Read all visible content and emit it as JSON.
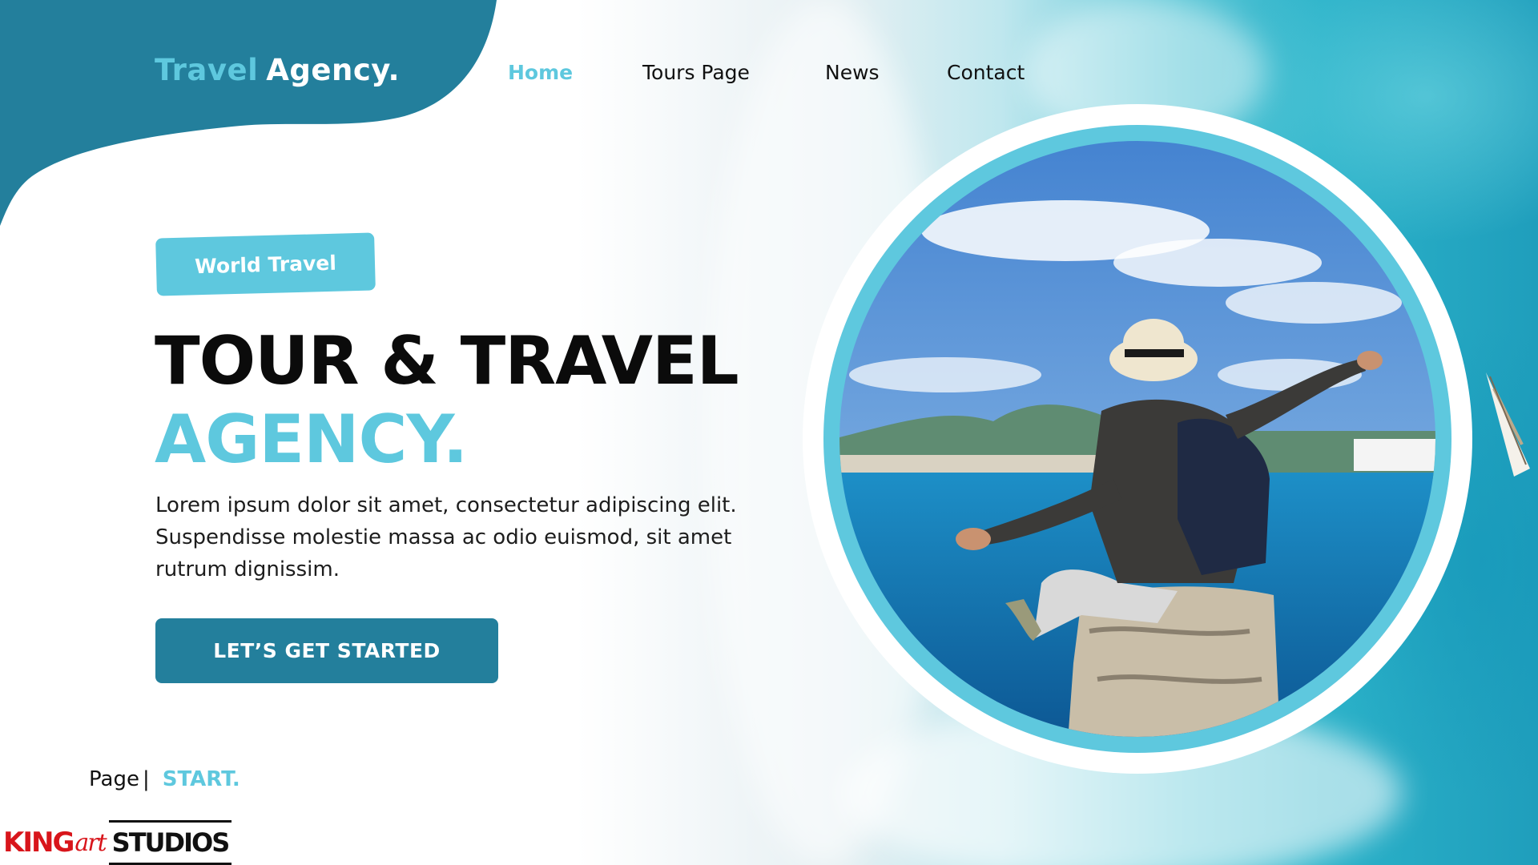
{
  "brand": {
    "word1": "Travel",
    "word2": "Agency."
  },
  "nav": [
    {
      "label": "Home",
      "active": true
    },
    {
      "label": "Tours Page",
      "active": false
    },
    {
      "label": "News",
      "active": false
    },
    {
      "label": "Contact",
      "active": false
    }
  ],
  "hero": {
    "tag": "World Travel",
    "headline_line1": "TOUR & TRAVEL",
    "headline_line2": "AGENCY.",
    "description": "Lorem ipsum dolor sit amet, consectetur adipiscing elit. Suspendisse molestie massa ac odio euismod, sit amet rutrum dignissim.",
    "cta": "LET’S GET STARTED"
  },
  "page_indicator": {
    "label": "Page",
    "separator": "|",
    "current": "START."
  },
  "logo": {
    "part1": "KING",
    "part2": "art",
    "part3": "STUDIOS"
  },
  "colors": {
    "accent": "#5ec8de",
    "primary": "#237f9c",
    "header_wave": "#237f9c",
    "text": "#0b0b0b"
  },
  "icons": [
    "traveler-photo",
    "sailboat"
  ]
}
